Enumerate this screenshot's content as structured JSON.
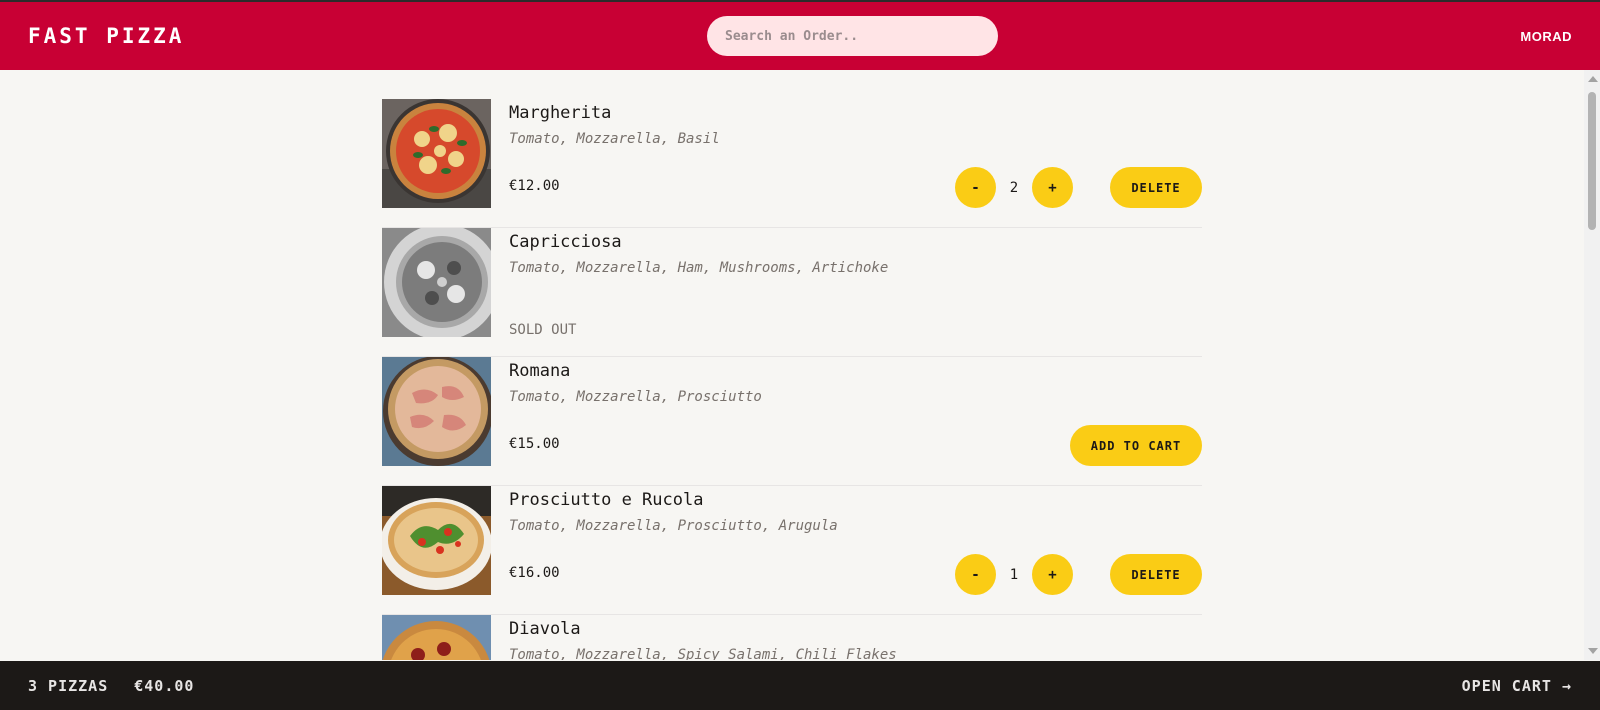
{
  "header": {
    "logo": "FAST PIZZA",
    "search_placeholder": "Search an Order..",
    "username": "MORAD"
  },
  "menu": [
    {
      "name": "Margherita",
      "ingredients": "Tomato, Mozzarella, Basil",
      "price": "€12.00",
      "sold_out": false,
      "in_cart": true,
      "quantity": "2",
      "delete_label": "DELETE"
    },
    {
      "name": "Capricciosa",
      "ingredients": "Tomato, Mozzarella, Ham, Mushrooms, Artichoke",
      "sold_out": true,
      "sold_out_label": "SOLD OUT"
    },
    {
      "name": "Romana",
      "ingredients": "Tomato, Mozzarella, Prosciutto",
      "price": "€15.00",
      "sold_out": false,
      "in_cart": false,
      "add_label": "ADD TO CART"
    },
    {
      "name": "Prosciutto e Rucola",
      "ingredients": "Tomato, Mozzarella, Prosciutto, Arugula",
      "price": "€16.00",
      "sold_out": false,
      "in_cart": true,
      "quantity": "1",
      "delete_label": "DELETE"
    },
    {
      "name": "Diavola",
      "ingredients": "Tomato, Mozzarella, Spicy Salami, Chili Flakes"
    }
  ],
  "controls": {
    "decrease": "-",
    "increase": "+"
  },
  "cart_bar": {
    "count": "3 PIZZAS",
    "total": "€40.00",
    "open_cart": "OPEN CART →"
  },
  "colors": {
    "brand": "#c80034",
    "accent": "#facc15",
    "footer": "#1c1917",
    "background": "#f7f6f3"
  }
}
